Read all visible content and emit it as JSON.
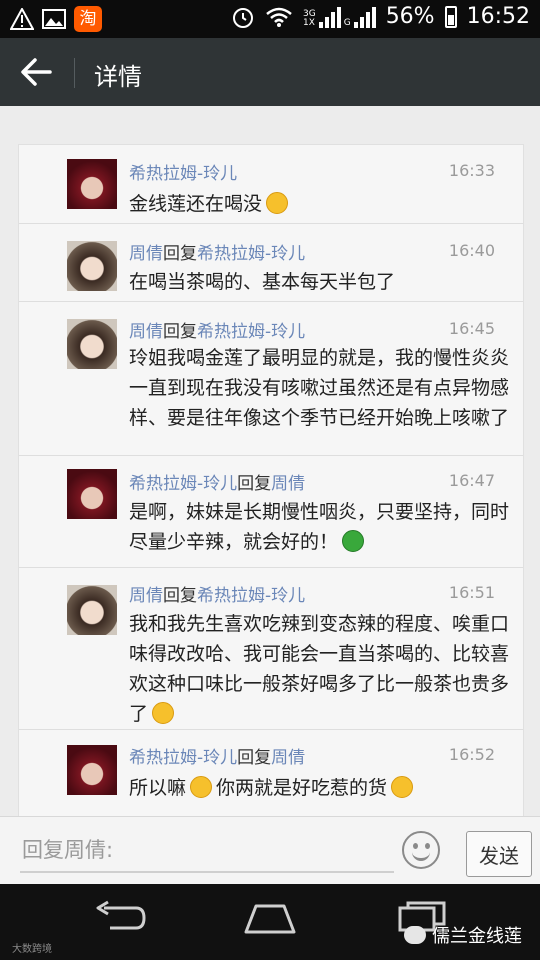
{
  "status_bar": {
    "network_top": "3G",
    "network_bottom": "1X",
    "network_g": "G",
    "battery": "56%",
    "time": "16:52"
  },
  "header": {
    "title": "详情"
  },
  "messages": [
    {
      "from": "希热拉姆-玲儿",
      "reply_label": "",
      "to": "",
      "time": "16:33",
      "text": "金线莲还在喝没",
      "emoji": "face"
    },
    {
      "from": "周倩",
      "reply_label": "回复",
      "to": "希热拉姆-玲儿",
      "time": "16:40",
      "text": "在喝当茶喝的、基本每天半包了",
      "emoji": ""
    },
    {
      "from": "周倩",
      "reply_label": "回复",
      "to": "希热拉姆-玲儿",
      "time": "16:45",
      "text": "玲姐我喝金莲了最明显的就是，我的慢性炎炎一直到现在我没有咳嗽过虽然还是有点异物感样、要是往年像这个季节已经开始晚上咳嗽了",
      "emoji": ""
    },
    {
      "from": "希热拉姆-玲儿",
      "reply_label": "回复",
      "to": "周倩",
      "time": "16:47",
      "text": "是啊，妹妹是长期慢性咽炎，只要坚持，同时尽量少辛辣，就会好的！",
      "emoji": "frog"
    },
    {
      "from": "周倩",
      "reply_label": "回复",
      "to": "希热拉姆-玲儿",
      "time": "16:51",
      "text": "我和我先生喜欢吃辣到变态辣的程度、唉重口味得改改哈、我可能会一直当茶喝的、比较喜欢这种口味比一般茶好喝多了比一般茶也贵多了",
      "emoji": "face"
    },
    {
      "from": "希热拉姆-玲儿",
      "reply_label": "回复",
      "to": "周倩",
      "time": "16:52",
      "text_a": "所以嘛",
      "text_b": "你两就是好吃惹的货",
      "emoji": "face"
    }
  ],
  "reply": {
    "placeholder": "回复周倩:",
    "send_label": "发送"
  },
  "footer": {
    "logo_text": "大数跨境",
    "brand_text": "儒兰金线莲"
  },
  "colors": {
    "name": "#6b87b8",
    "header_bg": "#2f3436",
    "status_bg": "#0c0c0c"
  }
}
